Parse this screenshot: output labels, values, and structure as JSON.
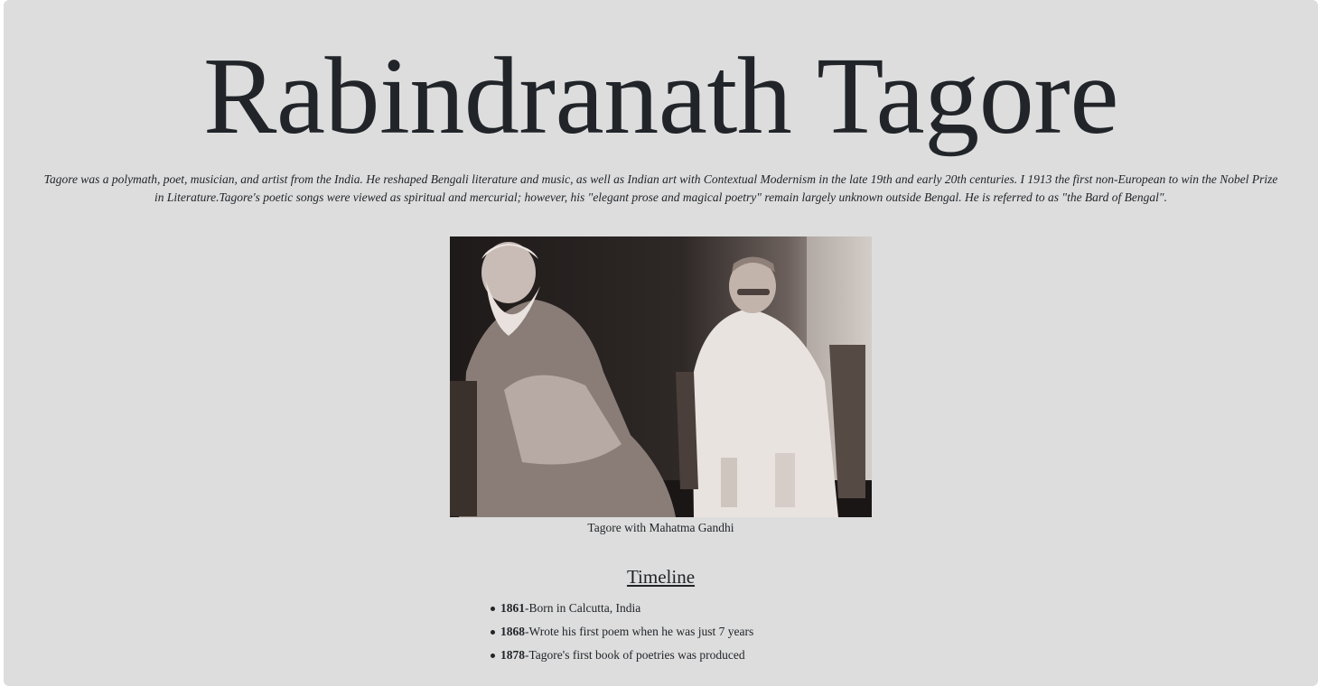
{
  "page": {
    "title": "Rabindranath Tagore",
    "intro": "Tagore was a polymath, poet, musician, and artist from the India. He reshaped Bengali literature and music, as well as Indian art with Contextual Modernism in the late 19th and early 20th centuries. I 1913 the first non-European to win the Nobel Prize in Literature.Tagore's poetic songs were viewed as spiritual and mercurial; however, his \"elegant prose and magical poetry\" remain largely unknown outside Bengal. He is referred to as \"the Bard of Bengal\"."
  },
  "figure": {
    "caption": "Tagore with Mahatma Gandhi"
  },
  "timeline": {
    "heading": "Timeline",
    "items": [
      {
        "year": "1861",
        "text": "-Born in Calcutta, India"
      },
      {
        "year": "1868",
        "text": "-Wrote his first poem when he was just 7 years"
      },
      {
        "year": "1878",
        "text": "-Tagore's first book of poetries was produced"
      }
    ]
  },
  "colors": {
    "background": "#dddddd",
    "text": "#212529"
  }
}
